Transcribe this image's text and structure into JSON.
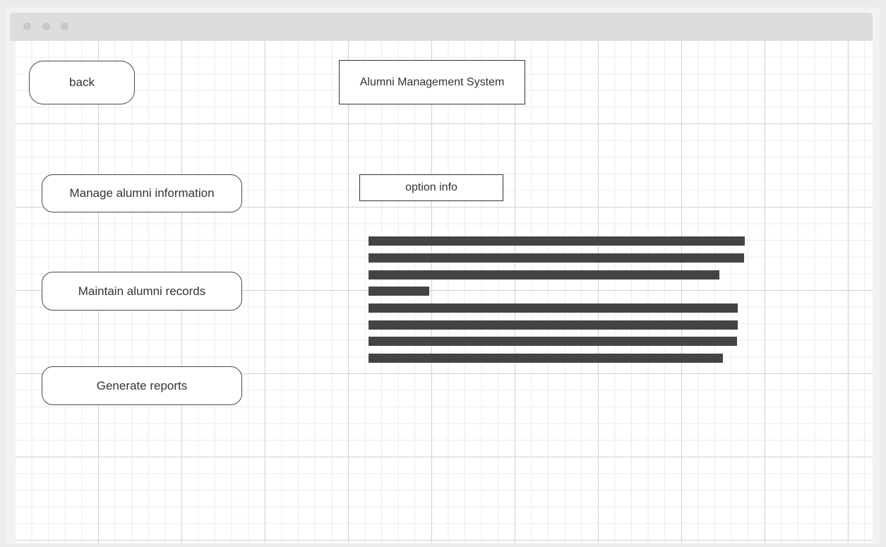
{
  "window": {
    "buttons": [
      "window-dot",
      "window-dot",
      "window-dot"
    ]
  },
  "header": {
    "back_label": "back",
    "title": "Alumni Management System"
  },
  "menu": {
    "items": [
      {
        "label": "Manage alumni information"
      },
      {
        "label": "Maintain alumni records"
      },
      {
        "label": "Generate reports"
      }
    ]
  },
  "content": {
    "section_label": "option info",
    "placeholder_line_count": 8
  },
  "colors": {
    "border": "#333333",
    "placeholder_text": "#444444",
    "titlebar": "#dddddd",
    "window_dot": "#c8c8c8"
  }
}
